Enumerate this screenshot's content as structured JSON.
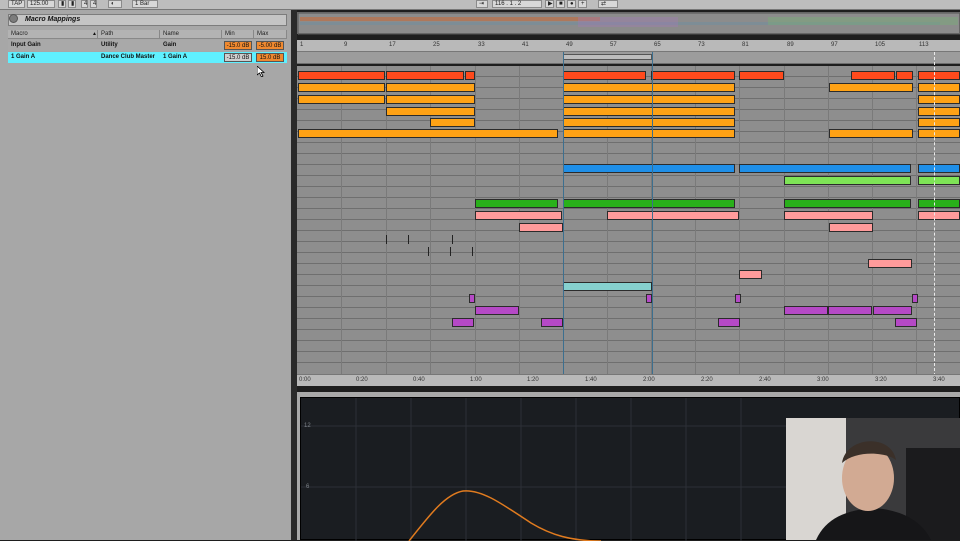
{
  "transport": {
    "tap_label": "TAP",
    "tempo": "125.00",
    "signature_num": "4",
    "signature_den": "4",
    "quantize": "1 Bar",
    "position": "116 . 1 . 2"
  },
  "macro_panel": {
    "title": "Macro Mappings",
    "columns": [
      "Macro",
      "Path",
      "Name",
      "Min",
      "Max"
    ],
    "rows": [
      {
        "macro": "Input Gain",
        "path": "Utility",
        "name": "Gain",
        "min": "-15.0 dB",
        "max": "-5.00 dB",
        "selected": false
      },
      {
        "macro": "1 Gain A",
        "path": "Dance Club Master",
        "name": "1 Gain A",
        "min": "-15.0 dB",
        "max": "15.0 dB",
        "selected": true
      }
    ]
  },
  "ruler": {
    "bars": [
      "1",
      "9",
      "17",
      "25",
      "33",
      "41",
      "49",
      "57",
      "65",
      "73",
      "81",
      "89",
      "97",
      "105",
      "113"
    ]
  },
  "timeline": {
    "ticks": [
      "0:00",
      "0:20",
      "0:40",
      "1:00",
      "1:20",
      "1:40",
      "2:00",
      "2:20",
      "2:40",
      "3:00",
      "3:20",
      "3:40"
    ]
  },
  "eq": {
    "gain_labels": [
      "12",
      "6"
    ],
    "curve_color": "#e07b1f"
  },
  "colors": {
    "orange_red": "#ff4a1c",
    "orange": "#ffa215",
    "blue": "#1f8fe8",
    "light_green": "#7ee356",
    "green": "#29b01a",
    "pink": "#ff9b9b",
    "cyan": "#86d1cf",
    "purple": "#b549c6",
    "selected_row": "#5ff0ff"
  }
}
